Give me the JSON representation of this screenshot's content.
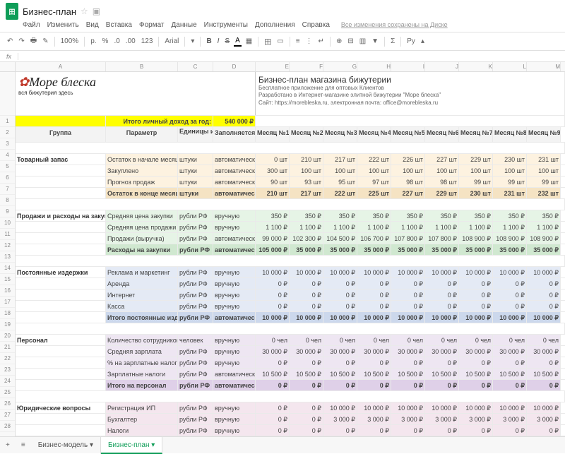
{
  "doc": {
    "title": "Бизнес-план",
    "icon_label": "田"
  },
  "menu": {
    "file": "Файл",
    "edit": "Изменить",
    "view": "Вид",
    "insert": "Вставка",
    "format": "Формат",
    "data": "Данные",
    "tools": "Инструменты",
    "addons": "Дополнения",
    "help": "Справка",
    "saved": "Все изменения сохранены на Диске"
  },
  "toolbar": {
    "zoom": "100%",
    "currency": "р.",
    "percent": "%",
    "dec_dec": ".0",
    "dec_inc": ".00",
    "more_fmt": "123",
    "font": "Arial",
    "size": "▾",
    "bold": "B",
    "italic": "I",
    "strike": "S",
    "fill": "▦",
    "border": "田",
    "merge": "▭",
    "halign": "≡",
    "valign": "⋮",
    "wrap": "↵",
    "link": "⊕",
    "comment": "⊟",
    "chart": "▥",
    "filter": "▼",
    "sigma": "Σ",
    "lang": "Ру"
  },
  "fx": "fx",
  "cols": [
    "A",
    "B",
    "C",
    "D",
    "E",
    "F",
    "G",
    "H",
    "I",
    "J",
    "K",
    "L",
    "M"
  ],
  "rownums": [
    "",
    "1",
    "2",
    "3",
    "4",
    "5",
    "6",
    "7",
    "8",
    "9",
    "10",
    "11",
    "12",
    "13",
    "14",
    "15",
    "16",
    "17",
    "18",
    "19",
    "20",
    "21",
    "22",
    "23",
    "24",
    "25",
    "26",
    "27",
    "28"
  ],
  "logo": {
    "line1a": "М",
    "line1b": "оре блеска",
    "line2": "вся бижутерия здесь"
  },
  "info": {
    "title": "Бизнес-план магазина бижутерии",
    "sub1": "Бесплатное приложение для оптовых Клиентов",
    "sub2": "Разработано в Интернет-магазине элитной бижутерии \"Море блеска\"",
    "sub3": "Сайт: https://morebleska.ru, электронная почта: office@morebleska.ru"
  },
  "income": {
    "label": "Итого личный доход за год:",
    "value": "540 000 ₽"
  },
  "hdr": {
    "group": "Группа",
    "param": "Параметр",
    "units": "Единицы измерения",
    "fill": "Заполняется",
    "months": [
      "Месяц №1",
      "Месяц №2",
      "Месяц №3",
      "Месяц №4",
      "Месяц №5",
      "Месяц №6",
      "Месяц №7",
      "Месяц №8",
      "Месяц №9"
    ]
  },
  "units": {
    "pcs": "штуки",
    "rub": "рубли РФ",
    "ppl": "человек"
  },
  "fill": {
    "auto": "автоматически",
    "manual": "вручную"
  },
  "groups": {
    "stock": "Товарный запас",
    "sales": "Продажи и расходы на закупки",
    "fixed": "Постоянные издержки",
    "staff": "Персонал",
    "legal": "Юридические вопросы"
  },
  "params": {
    "stock_start": "Остаток в начале месяца",
    "purchased": "Закуплено",
    "forecast": "Прогноз продаж",
    "stock_end": "Остаток в конце месяца",
    "avg_buy": "Средняя цена закупки",
    "avg_sell": "Средняя цена продажи",
    "revenue": "Продажи (выручка)",
    "cost_purch": "Расходы на закупки",
    "ads": "Реклама и маркетинг",
    "rent": "Аренда",
    "internet": "Интернет",
    "kassa": "Касса",
    "fixed_total": "Итого постоянные издержки",
    "emp_count": "Количество сотрудников",
    "avg_salary": "Средняя зарплата",
    "tax_pct": "% на зарплатные налоги",
    "tax_amt": "Зарплатные налоги",
    "staff_total": "Итого на персонал",
    "reg_ip": "Регистрация ИП",
    "accountant": "Бухгалтер",
    "taxes": "Налоги"
  },
  "data": {
    "stock_start": [
      "0 шт",
      "210 шт",
      "217 шт",
      "222 шт",
      "226 шт",
      "227 шт",
      "229 шт",
      "230 шт",
      "231 шт"
    ],
    "purchased": [
      "300 шт",
      "100 шт",
      "100 шт",
      "100 шт",
      "100 шт",
      "100 шт",
      "100 шт",
      "100 шт",
      "100 шт"
    ],
    "forecast": [
      "90 шт",
      "93 шт",
      "95 шт",
      "97 шт",
      "98 шт",
      "98 шт",
      "99 шт",
      "99 шт",
      "99 шт"
    ],
    "stock_end": [
      "210 шт",
      "217 шт",
      "222 шт",
      "225 шт",
      "227 шт",
      "229 шт",
      "230 шт",
      "231 шт",
      "232 шт"
    ],
    "avg_buy": [
      "350 ₽",
      "350 ₽",
      "350 ₽",
      "350 ₽",
      "350 ₽",
      "350 ₽",
      "350 ₽",
      "350 ₽",
      "350 ₽"
    ],
    "avg_sell": [
      "1 100 ₽",
      "1 100 ₽",
      "1 100 ₽",
      "1 100 ₽",
      "1 100 ₽",
      "1 100 ₽",
      "1 100 ₽",
      "1 100 ₽",
      "1 100 ₽"
    ],
    "revenue": [
      "99 000 ₽",
      "102 300 ₽",
      "104 500 ₽",
      "106 700 ₽",
      "107 800 ₽",
      "107 800 ₽",
      "108 900 ₽",
      "108 900 ₽",
      "108 900 ₽"
    ],
    "cost_purch": [
      "105 000 ₽",
      "35 000 ₽",
      "35 000 ₽",
      "35 000 ₽",
      "35 000 ₽",
      "35 000 ₽",
      "35 000 ₽",
      "35 000 ₽",
      "35 000 ₽"
    ],
    "ads": [
      "10 000 ₽",
      "10 000 ₽",
      "10 000 ₽",
      "10 000 ₽",
      "10 000 ₽",
      "10 000 ₽",
      "10 000 ₽",
      "10 000 ₽",
      "10 000 ₽"
    ],
    "rent": [
      "0 ₽",
      "0 ₽",
      "0 ₽",
      "0 ₽",
      "0 ₽",
      "0 ₽",
      "0 ₽",
      "0 ₽",
      "0 ₽"
    ],
    "internet": [
      "0 ₽",
      "0 ₽",
      "0 ₽",
      "0 ₽",
      "0 ₽",
      "0 ₽",
      "0 ₽",
      "0 ₽",
      "0 ₽"
    ],
    "kassa": [
      "0 ₽",
      "0 ₽",
      "0 ₽",
      "0 ₽",
      "0 ₽",
      "0 ₽",
      "0 ₽",
      "0 ₽",
      "0 ₽"
    ],
    "fixed_total": [
      "10 000 ₽",
      "10 000 ₽",
      "10 000 ₽",
      "10 000 ₽",
      "10 000 ₽",
      "10 000 ₽",
      "10 000 ₽",
      "10 000 ₽",
      "10 000 ₽"
    ],
    "emp_count": [
      "0 чел",
      "0 чел",
      "0 чел",
      "0 чел",
      "0 чел",
      "0 чел",
      "0 чел",
      "0 чел",
      "0 чел"
    ],
    "avg_salary": [
      "30 000 ₽",
      "30 000 ₽",
      "30 000 ₽",
      "30 000 ₽",
      "30 000 ₽",
      "30 000 ₽",
      "30 000 ₽",
      "30 000 ₽",
      "30 000 ₽"
    ],
    "tax_pct": [
      "0 ₽",
      "0 ₽",
      "0 ₽",
      "0 ₽",
      "0 ₽",
      "0 ₽",
      "0 ₽",
      "0 ₽",
      "0 ₽"
    ],
    "tax_amt": [
      "10 500 ₽",
      "10 500 ₽",
      "10 500 ₽",
      "10 500 ₽",
      "10 500 ₽",
      "10 500 ₽",
      "10 500 ₽",
      "10 500 ₽",
      "10 500 ₽"
    ],
    "staff_total": [
      "0 ₽",
      "0 ₽",
      "0 ₽",
      "0 ₽",
      "0 ₽",
      "0 ₽",
      "0 ₽",
      "0 ₽",
      "0 ₽"
    ],
    "reg_ip": [
      "0 ₽",
      "0 ₽",
      "10 000 ₽",
      "10 000 ₽",
      "10 000 ₽",
      "10 000 ₽",
      "10 000 ₽",
      "10 000 ₽",
      "10 000 ₽"
    ],
    "accountant": [
      "0 ₽",
      "0 ₽",
      "3 000 ₽",
      "3 000 ₽",
      "3 000 ₽",
      "3 000 ₽",
      "3 000 ₽",
      "3 000 ₽",
      "3 000 ₽"
    ],
    "taxes": [
      "0 ₽",
      "0 ₽",
      "0 ₽",
      "0 ₽",
      "0 ₽",
      "0 ₽",
      "0 ₽",
      "0 ₽",
      "0 ₽"
    ]
  },
  "tabs": {
    "model": "Бизнес-модель",
    "plan": "Бизнес-план"
  }
}
